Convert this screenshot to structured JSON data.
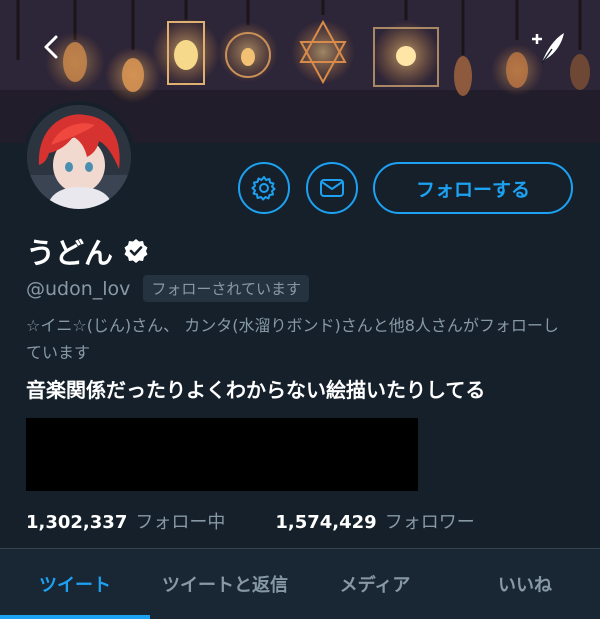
{
  "colors": {
    "background": "#15202b",
    "accent": "#1da1f2",
    "secondary_text": "#8899a6",
    "tab_bar": "#192734"
  },
  "header": {
    "back_icon": "chevron-left-icon",
    "compose_icon": "compose-tweet-icon"
  },
  "profile": {
    "display_name": "うどん",
    "verified_icon": "verified-badge-icon",
    "handle": "@udon_lov",
    "follows_you": "フォローされています",
    "followed_by": "☆イニ☆(じん)さん、 カンタ(水溜りボンド)さんと他8人さんがフォローしています",
    "bio": "音楽関係だったりよくわからない絵描いたりしてる"
  },
  "actions": {
    "settings_icon": "gear-icon",
    "message_icon": "mail-icon",
    "follow_label": "フォローする"
  },
  "stats": {
    "following_count": "1,302,337",
    "following_label": "フォロー中",
    "followers_count": "1,574,429",
    "followers_label": "フォロワー"
  },
  "tabs": [
    {
      "label": "ツイート",
      "active": true
    },
    {
      "label": "ツイートと返信",
      "active": false
    },
    {
      "label": "メディア",
      "active": false
    },
    {
      "label": "いいね",
      "active": false
    }
  ]
}
